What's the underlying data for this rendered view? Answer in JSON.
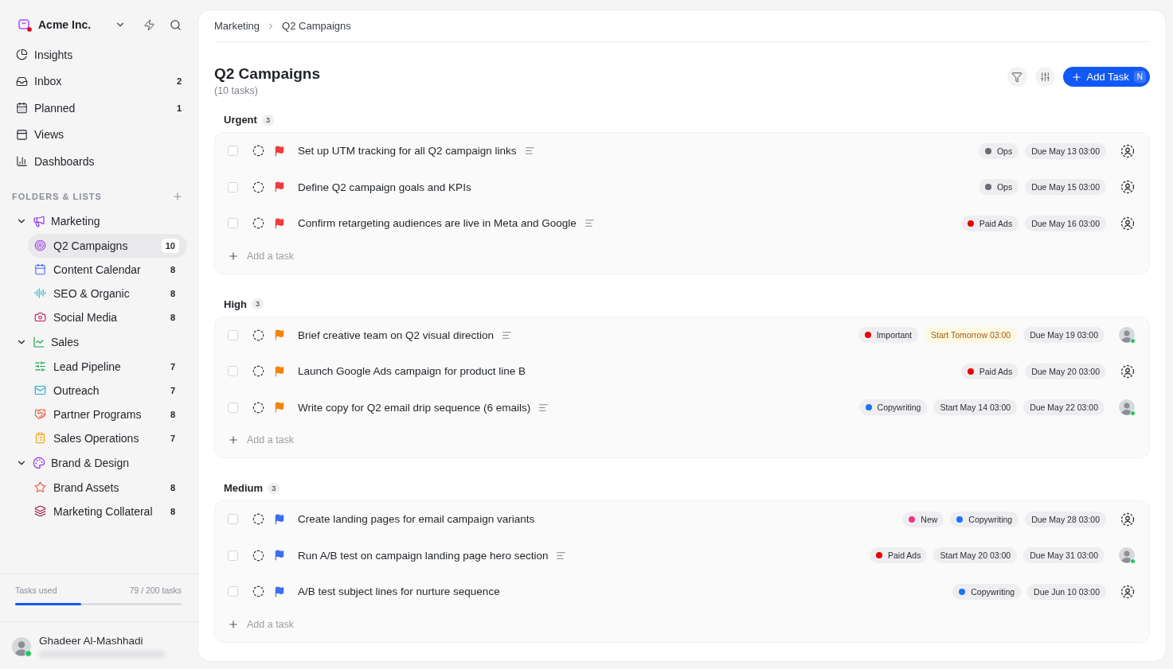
{
  "workspace": {
    "name": "Acme Inc.",
    "notification": true
  },
  "nav": [
    {
      "label": "Insights"
    },
    {
      "label": "Inbox",
      "count": "2"
    },
    {
      "label": "Planned",
      "count": "1"
    },
    {
      "label": "Views"
    },
    {
      "label": "Dashboards"
    }
  ],
  "folders_heading": "FOLDERS & LISTS",
  "folders": [
    {
      "label": "Marketing",
      "expanded": true,
      "lists": [
        {
          "label": "Q2 Campaigns",
          "count": "10",
          "selected": true
        },
        {
          "label": "Content Calendar",
          "count": "8",
          "selected": false
        },
        {
          "label": "SEO & Organic",
          "count": "8",
          "selected": false
        },
        {
          "label": "Social Media",
          "count": "8",
          "selected": false
        }
      ]
    },
    {
      "label": "Sales",
      "expanded": true,
      "lists": [
        {
          "label": "Lead Pipeline",
          "count": "7",
          "selected": false
        },
        {
          "label": "Outreach",
          "count": "7",
          "selected": false
        },
        {
          "label": "Partner Programs",
          "count": "8",
          "selected": false
        },
        {
          "label": "Sales Operations",
          "count": "7",
          "selected": false
        }
      ]
    },
    {
      "label": "Brand & Design",
      "expanded": true,
      "lists": [
        {
          "label": "Brand Assets",
          "count": "8",
          "selected": false
        },
        {
          "label": "Marketing Collateral",
          "count": "8",
          "selected": false
        }
      ]
    }
  ],
  "usage": {
    "label": "Tasks used",
    "reading": "79 / 200 tasks",
    "level": 0.395
  },
  "user": {
    "name": "Ghadeer Al-Mashhadi",
    "online": true
  },
  "breadcrumb": [
    "Marketing",
    "Q2 Campaigns"
  ],
  "page": {
    "title": "Q2 Campaigns",
    "subtitle": "(10 tasks)"
  },
  "add_task_button": {
    "label": "Add Task",
    "shortcut": "N"
  },
  "groups": [
    {
      "name": "Urgent",
      "count": "3",
      "color": "#ef3b3b",
      "add_label": "Add a task",
      "tasks": [
        {
          "title": "Set up UTM tracking for all Q2 campaign links",
          "checked": false,
          "notes": true,
          "tags": [
            {
              "label": "Ops",
              "color": "#6b6b73"
            }
          ],
          "due": "Due May 13 03:00",
          "assigned": false
        },
        {
          "title": "Define Q2 campaign goals and KPIs",
          "checked": false,
          "notes": false,
          "tags": [
            {
              "label": "Ops",
              "color": "#6b6b73"
            }
          ],
          "due": "Due May 15 03:00",
          "assigned": false
        },
        {
          "title": "Confirm retargeting audiences are live in Meta and Google",
          "checked": false,
          "notes": true,
          "tags": [
            {
              "label": "Paid Ads",
              "color": "#e8000b"
            }
          ],
          "due": "Due May 16 03:00",
          "assigned": false
        }
      ]
    },
    {
      "name": "High",
      "count": "3",
      "color": "#f5820b",
      "add_label": "Add a task",
      "tasks": [
        {
          "title": "Brief creative team on Q2 visual direction",
          "checked": false,
          "notes": true,
          "tags": [
            {
              "label": "Important",
              "color": "#e8000b"
            }
          ],
          "start": {
            "label": "Start Tomorrow 03:00",
            "soon": true
          },
          "due": "Due May 19 03:00",
          "assigned": true
        },
        {
          "title": "Launch Google Ads campaign for product line B",
          "checked": false,
          "notes": false,
          "tags": [
            {
              "label": "Paid Ads",
              "color": "#e8000b"
            }
          ],
          "due": "Due May 20 03:00",
          "assigned": false
        },
        {
          "title": "Write copy for Q2 email drip sequence (6 emails)",
          "checked": false,
          "notes": true,
          "tags": [
            {
              "label": "Copywriting",
              "color": "#1a73ff"
            }
          ],
          "start": {
            "label": "Start May 14 03:00",
            "soon": false
          },
          "due": "Due May 22 03:00",
          "assigned": true
        }
      ]
    },
    {
      "name": "Medium",
      "count": "3",
      "color": "#3b6ef0",
      "add_label": "Add a task",
      "tasks": [
        {
          "title": "Create landing pages for email campaign variants",
          "checked": false,
          "notes": false,
          "tags": [
            {
              "label": "New",
              "color": "#f0338a"
            },
            {
              "label": "Copywriting",
              "color": "#1a73ff"
            }
          ],
          "due": "Due May 28 03:00",
          "assigned": false
        },
        {
          "title": "Run A/B test on campaign landing page hero section",
          "checked": false,
          "notes": true,
          "tags": [
            {
              "label": "Paid Ads",
              "color": "#e8000b"
            }
          ],
          "start": {
            "label": "Start May 20 03:00",
            "soon": false
          },
          "due": "Due May 31 03:00",
          "assigned": true
        },
        {
          "title": "A/B test subject lines for nurture sequence",
          "checked": false,
          "notes": false,
          "tags": [
            {
              "label": "Copywriting",
              "color": "#1a73ff"
            }
          ],
          "due": "Due Jun 10 03:00",
          "assigned": false
        }
      ]
    }
  ]
}
